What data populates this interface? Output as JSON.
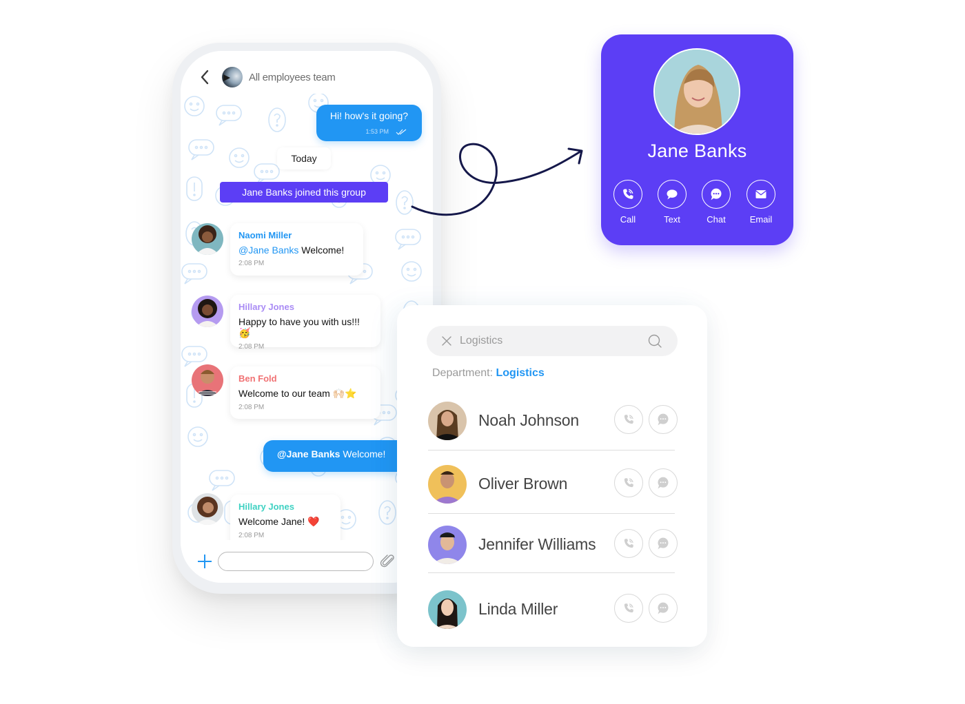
{
  "chat": {
    "header": {
      "back_icon": "chevron-left-icon",
      "group_name": "All employees team"
    },
    "messages_outgoing": [
      {
        "text": "Hi! how's it going?",
        "time": "1:53 PM",
        "status_icon": "double-check-icon"
      },
      {
        "mention": "@Jane Banks",
        "text": " Welcome!"
      }
    ],
    "date_chip": "Today",
    "system_message": "Jane Banks joined this group",
    "messages_incoming": [
      {
        "sender": "Naomi Miller",
        "sender_color": "#2196f3",
        "mention": "@Jane Banks",
        "text": " Welcome!",
        "time": "2:08 PM"
      },
      {
        "sender": "Hillary Jones",
        "sender_color": "#a98bf5",
        "text": "Happy to have you with us!!! 🥳",
        "time": "2:08 PM"
      },
      {
        "sender": "Ben Fold",
        "sender_color": "#f07173",
        "text": "Welcome to our team 🙌🏻⭐",
        "time": "2:08 PM"
      },
      {
        "sender": "Hillary Jones",
        "sender_color": "#3ed1c2",
        "text": "Welcome Jane! ❤️",
        "time": "2:08 PM"
      }
    ],
    "composer": {
      "add_icon": "plus-icon",
      "placeholder": "",
      "value": "",
      "attach_icon": "paperclip-icon"
    }
  },
  "contact_card": {
    "name": "Jane Banks",
    "background_color": "#5c3ef5",
    "actions": [
      {
        "label": "Call",
        "icon": "phone-icon"
      },
      {
        "label": "Text",
        "icon": "speech-bubble-icon"
      },
      {
        "label": "Chat",
        "icon": "chat-dots-icon"
      },
      {
        "label": "Email",
        "icon": "envelope-icon"
      }
    ]
  },
  "directory": {
    "search": {
      "value": "Logistics",
      "clear_icon": "close-icon",
      "search_icon": "search-icon"
    },
    "department_label": "Department:",
    "department_value": "Logistics",
    "people": [
      {
        "name": "Noah Johnson"
      },
      {
        "name": "Oliver Brown"
      },
      {
        "name": "Jennifer Williams"
      },
      {
        "name": "Linda Miller"
      }
    ]
  },
  "colors": {
    "accent_blue": "#2196f3",
    "brand_purple": "#5c3ef5",
    "arrow_navy": "#15184a"
  }
}
